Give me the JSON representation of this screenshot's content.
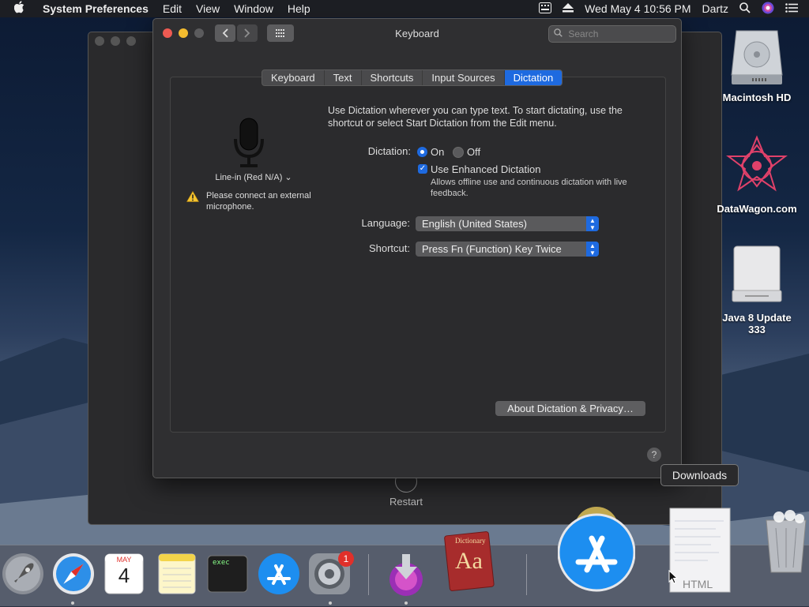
{
  "menubar": {
    "app_name": "System Preferences",
    "menus": [
      "Edit",
      "View",
      "Window",
      "Help"
    ],
    "datetime": "Wed May 4  10:56 PM",
    "user": "Dartz"
  },
  "window": {
    "title": "Keyboard",
    "search_placeholder": "Search",
    "tabs": [
      {
        "label": "Keyboard",
        "active": false
      },
      {
        "label": "Text",
        "active": false
      },
      {
        "label": "Shortcuts",
        "active": false
      },
      {
        "label": "Input Sources",
        "active": false
      },
      {
        "label": "Dictation",
        "active": true
      }
    ],
    "mic_source": "Line-in (Red N/A) ⌄",
    "warning": "Please connect an external microphone.",
    "description": "Use Dictation wherever you can type text. To start dictating, use the shortcut or select Start Dictation from the Edit menu.",
    "dictation_label": "Dictation:",
    "dictation_on": "On",
    "dictation_off": "Off",
    "dictation_value": "On",
    "enhanced_label": "Use Enhanced Dictation",
    "enhanced_checked": true,
    "enhanced_sub": "Allows offline use and continuous dictation with live feedback.",
    "language_label": "Language:",
    "language_value": "English (United States)",
    "shortcut_label": "Shortcut:",
    "shortcut_value": "Press Fn (Function) Key Twice",
    "privacy_button": "About Dictation & Privacy…",
    "help": "?"
  },
  "background_window": {
    "restart_label": "Restart"
  },
  "desktop": {
    "icons": [
      "Macintosh HD",
      "DataWagon.com",
      "Java 8 Update 333"
    ]
  },
  "tooltip": "Downloads",
  "dock": {
    "calendar_month": "MAY",
    "calendar_day": "4",
    "terminal_text": "exec",
    "prefs_badge": "1",
    "dictionary_text": "Aa",
    "dictionary_title": "Dictionary",
    "html_label": "HTML"
  },
  "colors": {
    "accent": "#1e6ae0",
    "window_bg": "#2f2f31",
    "badge": "#e0302a"
  }
}
